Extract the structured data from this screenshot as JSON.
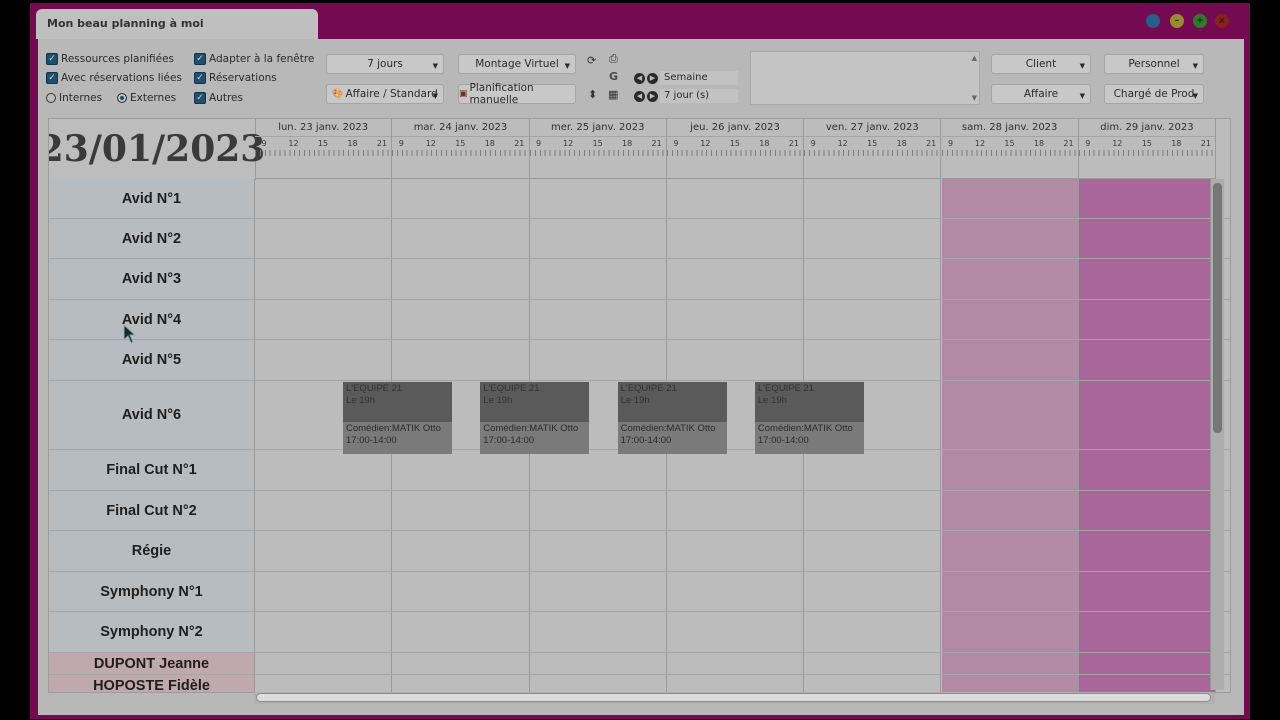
{
  "window": {
    "title": "Mon beau planning à moi",
    "controls": [
      {
        "name": "minimize",
        "color": "#9b8b2c"
      },
      {
        "name": "maximize",
        "color": "#2f7a2a"
      },
      {
        "name": "close",
        "color": "#8a1f1f"
      }
    ]
  },
  "filters": {
    "ressources_planifiees": "Ressources planifiées",
    "reservations_liees": "Avec réservations liées",
    "internes": "Internes",
    "externes": "Externes",
    "adapter_fenetre": "Adapter à la fenêtre",
    "reservations": "Réservations",
    "autres": "Autres"
  },
  "toolbar": {
    "period": "7 jours",
    "montage": "Montage Virtuel",
    "affaire_standard": "Affaire / Standard",
    "planification": "Planification manuelle",
    "nav_semaine": "Semaine",
    "nav_jours": "7 jour (s)",
    "client": "Client",
    "personnel": "Personnel",
    "affaire": "Affaire",
    "charge_prod": "Chargé de Prod"
  },
  "planning": {
    "current_date": "23/01/2023",
    "hour_ticks": [
      "9",
      "12",
      "15",
      "18",
      "21"
    ],
    "days": [
      {
        "label": "lun. 23 janv. 2023",
        "weekend": false
      },
      {
        "label": "mar. 24 janv. 2023",
        "weekend": false
      },
      {
        "label": "mer. 25 janv. 2023",
        "weekend": false
      },
      {
        "label": "jeu. 26 janv. 2023",
        "weekend": false
      },
      {
        "label": "ven. 27 janv. 2023",
        "weekend": false
      },
      {
        "label": "sam. 28 janv. 2023",
        "weekend": "sat"
      },
      {
        "label": "dim. 29 janv. 2023",
        "weekend": "sun"
      }
    ],
    "resources": [
      {
        "label": "Avid N°1",
        "type": "room"
      },
      {
        "label": "Avid N°2",
        "type": "room"
      },
      {
        "label": "Avid N°3",
        "type": "room"
      },
      {
        "label": "Avid N°4",
        "type": "room"
      },
      {
        "label": "Avid N°5",
        "type": "room"
      },
      {
        "label": "Avid N°6",
        "type": "room"
      },
      {
        "label": "Final Cut N°1",
        "type": "room"
      },
      {
        "label": "Final Cut N°2",
        "type": "room"
      },
      {
        "label": "Régie",
        "type": "room"
      },
      {
        "label": "Symphony N°1",
        "type": "room"
      },
      {
        "label": "Symphony N°2",
        "type": "room"
      },
      {
        "label": "DUPONT Jeanne",
        "type": "person"
      },
      {
        "label": "HOPOSTE Fidèle",
        "type": "person"
      }
    ],
    "events": [
      {
        "resource": 5,
        "day": 0,
        "title": "L'EQUIPE 21",
        "subtitle": "Le 19h",
        "person": "Comédien:MATIK Otto",
        "time": "17:00-14:00"
      },
      {
        "resource": 5,
        "day": 1,
        "title": "L'EQUIPE 21",
        "subtitle": "Le 19h",
        "person": "Comédien:MATIK Otto",
        "time": "17:00-14:00"
      },
      {
        "resource": 5,
        "day": 2,
        "title": "L'EQUIPE 21",
        "subtitle": "Le 19h",
        "person": "Comédien:MATIK Otto",
        "time": "17:00-14:00"
      },
      {
        "resource": 5,
        "day": 3,
        "title": "L'EQUIPE 21",
        "subtitle": "Le 19h",
        "person": "Comédien:MATIK Otto",
        "time": "17:00-14:00"
      }
    ]
  }
}
